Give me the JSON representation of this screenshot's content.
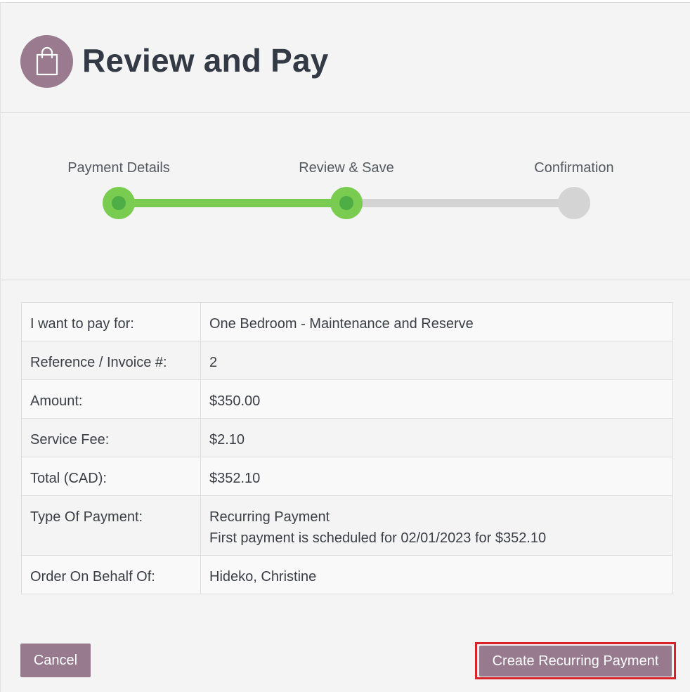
{
  "header": {
    "title": "Review and Pay",
    "icon": "shopping-bag-icon",
    "icon_bg_color": "#9a7a8e"
  },
  "stepper": {
    "steps": [
      {
        "label": "Payment Details",
        "status": "done"
      },
      {
        "label": "Review & Save",
        "status": "current"
      },
      {
        "label": "Confirmation",
        "status": "pending"
      }
    ],
    "progress_color": "#79cc50",
    "pending_color": "#d4d4d4"
  },
  "details": {
    "rows": [
      {
        "label": "I want to pay for:",
        "value": "One Bedroom - Maintenance and Reserve"
      },
      {
        "label": "Reference / Invoice #:",
        "value": "2"
      },
      {
        "label": "Amount:",
        "value": "$350.00"
      },
      {
        "label": "Service Fee:",
        "value": "$2.10"
      },
      {
        "label": "Total (CAD):",
        "value": "$352.10"
      },
      {
        "label": "Type Of Payment:",
        "value": "Recurring Payment",
        "value_line2": "First payment is scheduled for 02/01/2023 for $352.10"
      },
      {
        "label": "Order On Behalf Of:",
        "value": "Hideko, Christine"
      }
    ]
  },
  "actions": {
    "cancel_label": "Cancel",
    "create_label": "Create Recurring Payment",
    "button_color": "#987a8f",
    "highlight_color": "#d8232a"
  }
}
